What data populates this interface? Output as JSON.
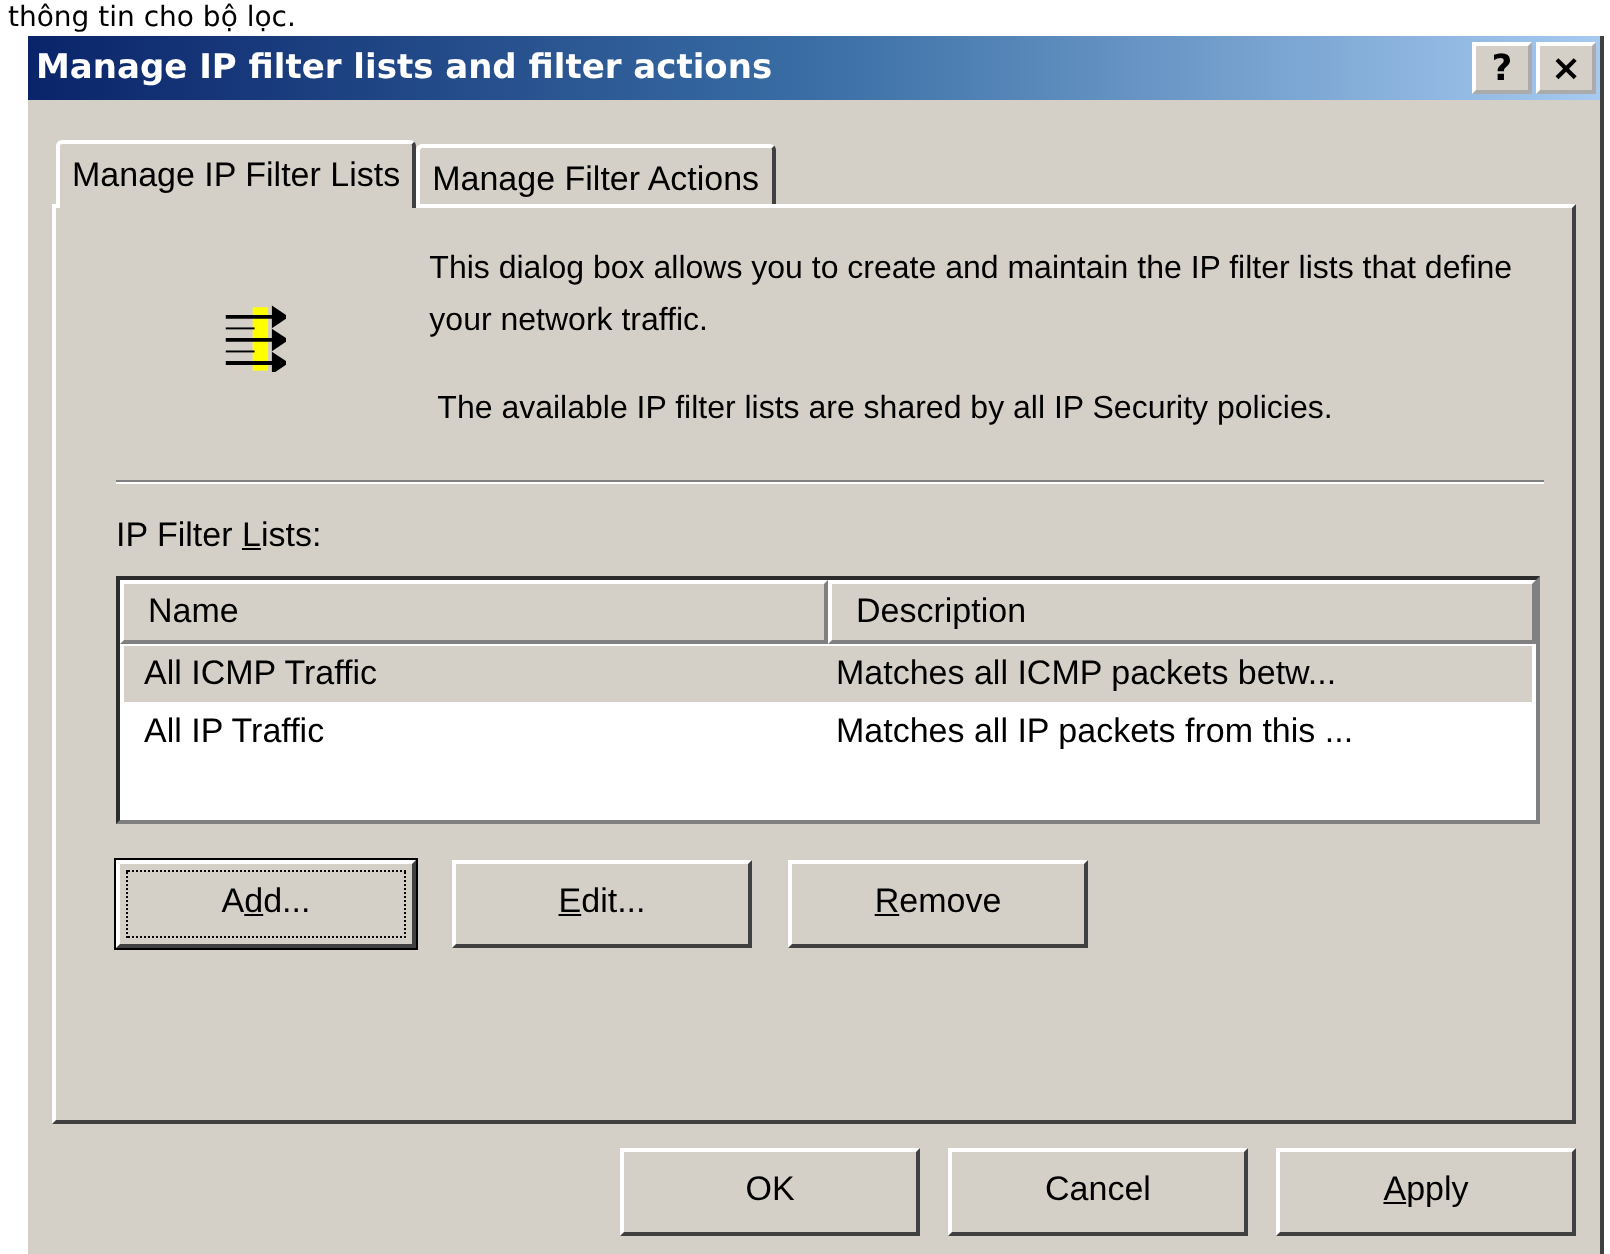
{
  "caption": "thông tin cho bộ lọc.",
  "window": {
    "title": "Manage IP filter lists and filter actions",
    "help_button": "?",
    "close_button": "×"
  },
  "tabs": [
    {
      "label": "Manage IP Filter Lists",
      "selected": true
    },
    {
      "label": "Manage Filter Actions",
      "selected": false
    }
  ],
  "intro": [
    "This dialog box allows you to create and maintain the IP filter lists that define your network traffic.",
    "The available IP filter lists are shared by all IP Security policies."
  ],
  "list_label": {
    "before": "IP Filter ",
    "mnemonic": "L",
    "after": "ists:"
  },
  "table": {
    "columns": [
      "Name",
      "Description"
    ],
    "rows": [
      {
        "name": "All ICMP Traffic",
        "description": "Matches all ICMP packets betw...",
        "selected": true
      },
      {
        "name": "All IP Traffic",
        "description": "Matches all IP packets from this ...",
        "selected": false
      }
    ]
  },
  "list_buttons": [
    {
      "before": "A",
      "mnemonic": "d",
      "after": "d...",
      "focused": true
    },
    {
      "mnemonic": "E",
      "after": "dit...",
      "focused": false
    },
    {
      "mnemonic": "R",
      "after": "emove",
      "focused": false
    }
  ],
  "dialog_buttons": [
    {
      "before": "OK"
    },
    {
      "before": "Cancel"
    },
    {
      "mnemonic": "A",
      "after": "pply"
    }
  ]
}
